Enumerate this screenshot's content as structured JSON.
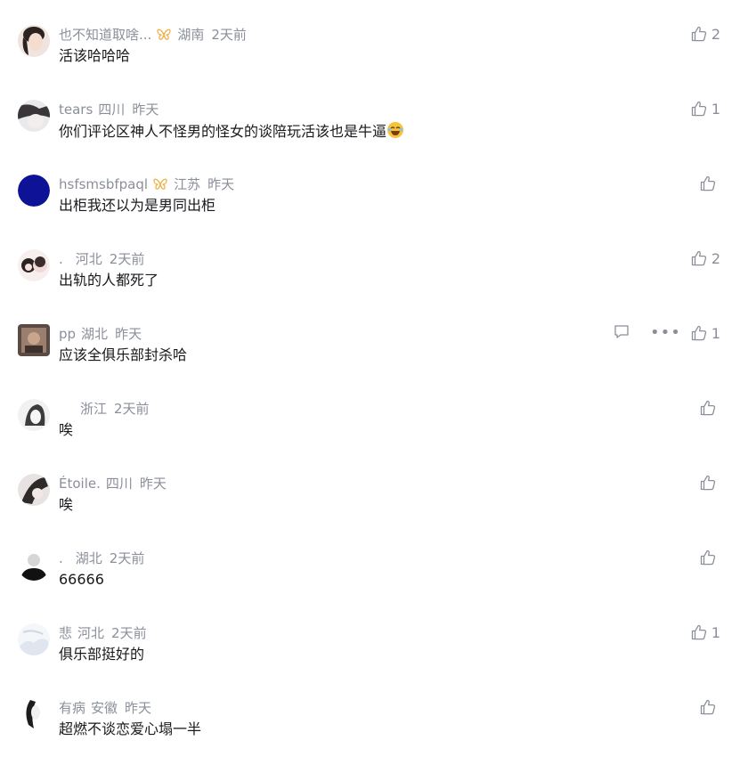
{
  "comments": [
    {
      "user": "也不知道取啥...",
      "badge": true,
      "location": "湖南",
      "time": "2天前",
      "text": "活该哈哈哈",
      "likes": "2"
    },
    {
      "user": "tears",
      "badge": false,
      "location": "四川",
      "time": "昨天",
      "text": "你们评论区神人不怪男的怪女的谈陪玩活该也是牛逼",
      "likes": "1"
    },
    {
      "user": "hsfsmsbfpaql",
      "badge": true,
      "location": "江苏",
      "time": "昨天",
      "text": "出柜我还以为是男同出柜",
      "likes": ""
    },
    {
      "user": ".",
      "badge": false,
      "location": "河北",
      "time": "2天前",
      "text": "出轨的人都死了",
      "likes": "2"
    },
    {
      "user": "pp",
      "badge": false,
      "location": "湖北",
      "time": "昨天",
      "text": "应该全俱乐部封杀哈",
      "likes": "1"
    },
    {
      "user": "",
      "badge": false,
      "location": "浙江",
      "time": "2天前",
      "text": "唉",
      "likes": ""
    },
    {
      "user": "Étoile.",
      "badge": false,
      "location": "四川",
      "time": "昨天",
      "text": "唉",
      "likes": ""
    },
    {
      "user": ".",
      "badge": false,
      "location": "湖北",
      "time": "2天前",
      "text": "66666",
      "likes": ""
    },
    {
      "user": "悲",
      "badge": false,
      "location": "河北",
      "time": "2天前",
      "text": "俱乐部挺好的",
      "likes": "1"
    },
    {
      "user": "有病",
      "badge": false,
      "location": "安徽",
      "time": "昨天",
      "text": "超燃不谈恋爱心塌一半",
      "likes": ""
    }
  ],
  "colors": {
    "meta": "#8a8f99",
    "text": "#18191c",
    "badge": "#f0b04a"
  }
}
